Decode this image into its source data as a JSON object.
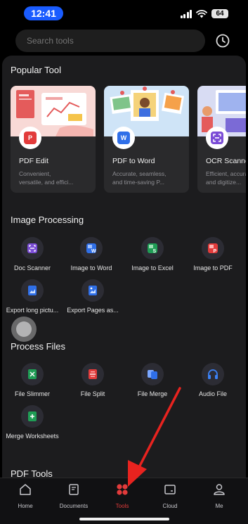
{
  "status_bar": {
    "time": "12:41",
    "battery": "64"
  },
  "search": {
    "placeholder": "Search tools"
  },
  "popular": {
    "title": "Popular Tool",
    "cards": [
      {
        "title": "PDF Edit",
        "desc1": "Convenient,",
        "desc2": "versatile, and effici...",
        "badge": "P",
        "badge_color": "#e23b3b"
      },
      {
        "title": "PDF to Word",
        "desc1": "Accurate, seamless,",
        "desc2": "and time-saving P...",
        "badge": "W",
        "badge_color": "#2f6fe8"
      },
      {
        "title": "OCR Scanner",
        "desc1": "Efficient, accurate,",
        "desc2": "and digitize...",
        "badge": "",
        "badge_color": "#7b4dd6"
      }
    ]
  },
  "image_processing": {
    "title": "Image Processing",
    "tools": [
      {
        "label": "Doc Scanner",
        "icon": "doc-scanner-icon"
      },
      {
        "label": "Image to Word",
        "icon": "image-to-word-icon"
      },
      {
        "label": "Image to Excel",
        "icon": "image-to-excel-icon"
      },
      {
        "label": "Image to PDF",
        "icon": "image-to-pdf-icon"
      },
      {
        "label": "Export long pictu...",
        "icon": "export-long-picture-icon"
      },
      {
        "label": "Export Pages as...",
        "icon": "export-pages-icon"
      }
    ]
  },
  "process_files": {
    "title": "Process Files",
    "tools": [
      {
        "label": "File Slimmer",
        "icon": "file-slimmer-icon"
      },
      {
        "label": "File Split",
        "icon": "file-split-icon"
      },
      {
        "label": "File Merge",
        "icon": "file-merge-icon"
      },
      {
        "label": "Audio File",
        "icon": "audio-file-icon"
      },
      {
        "label": "Merge Worksheets",
        "icon": "merge-worksheets-icon"
      }
    ]
  },
  "pdf_tools": {
    "title": "PDF Tools"
  },
  "tabbar": {
    "tabs": [
      {
        "label": "Home"
      },
      {
        "label": "Documents"
      },
      {
        "label": "Tools"
      },
      {
        "label": "Cloud"
      },
      {
        "label": "Me"
      }
    ],
    "active_color": "#e23b3b"
  }
}
